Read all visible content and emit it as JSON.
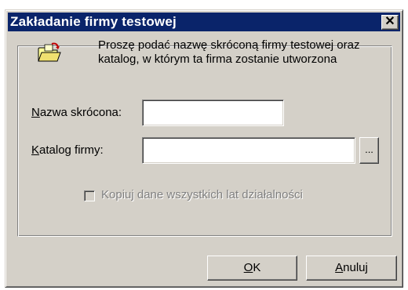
{
  "window": {
    "title": "Zakładanie firmy testowej",
    "close_glyph": "✕"
  },
  "content": {
    "description": "Proszę podać nazwę skróconą firmy testowej oraz katalog, w którym ta firma zostanie utworzona",
    "icon": "folder-new-icon"
  },
  "fields": {
    "short_name": {
      "label_accel": "N",
      "label_rest": "azwa skrócona:",
      "value": ""
    },
    "directory": {
      "label_accel": "K",
      "label_rest": "atalog firmy:",
      "value": "",
      "browse_label": "..."
    }
  },
  "options": {
    "copy_all_years": {
      "label": "Kopiuj dane wszystkich lat działalności",
      "checked": false,
      "enabled": false
    }
  },
  "buttons": {
    "ok_accel": "O",
    "ok_rest": "K",
    "cancel_accel": "A",
    "cancel_rest": "nuluj"
  },
  "colors": {
    "title_bar": "#0a246a",
    "face": "#d4d0c8",
    "disabled_text": "#808080"
  }
}
